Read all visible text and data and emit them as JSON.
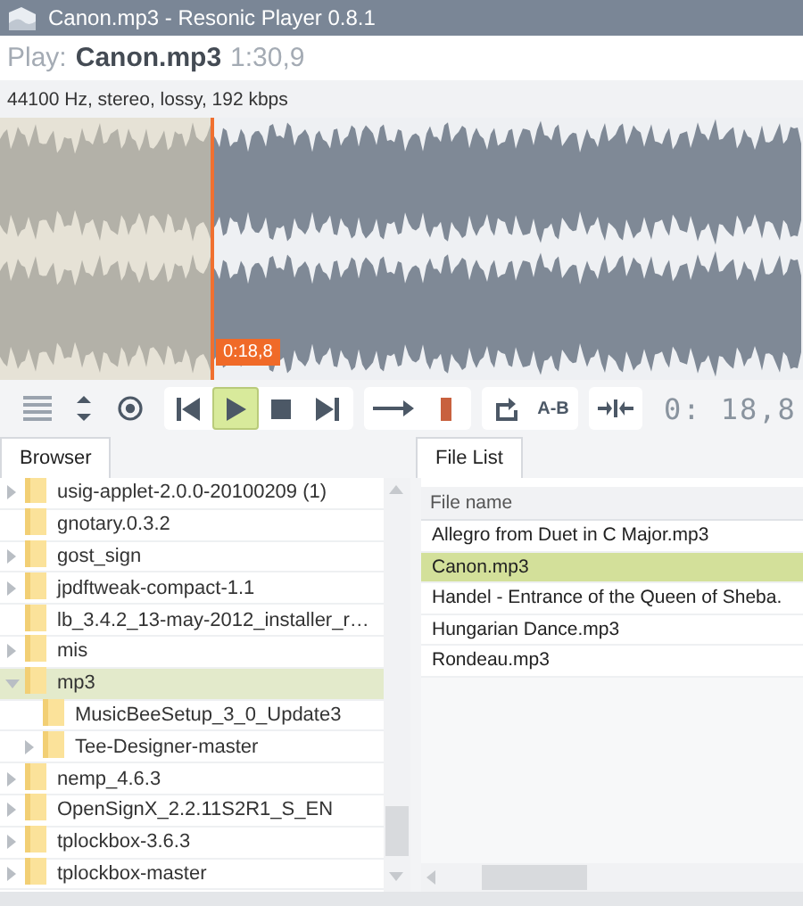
{
  "window": {
    "title": "Canon.mp3 - Resonic Player 0.8.1"
  },
  "now_playing": {
    "prefix": "Play:",
    "file": "Canon.mp3",
    "duration": "1:30,9"
  },
  "info": "44100 Hz, stereo, lossy, 192 kbps",
  "waveform": {
    "position_label": "0:18,8",
    "level": 0.265
  },
  "transport": [
    {
      "kind": "previous",
      "selected": false
    },
    {
      "kind": "play",
      "selected": true
    },
    {
      "kind": "stop",
      "selected": false
    },
    {
      "kind": "next",
      "selected": false
    }
  ],
  "ab_button": "A-B",
  "time_display": "0: 18,8",
  "tabs": [
    {
      "label": "Browser",
      "selected": true
    },
    {
      "label": "File List",
      "selected": true
    }
  ],
  "browser": [
    {
      "label": "usig-applet-2.0.0-20100209 (1)",
      "expanded": false,
      "selected": false
    },
    {
      "label": "gnotary.0.3.2",
      "selected": false
    },
    {
      "label": "gost_sign",
      "expanded": false,
      "selected": false
    },
    {
      "label": "jpdftweak-compact-1.1",
      "expanded": false,
      "selected": false
    },
    {
      "label": "lb_3.4.2_13-may-2012_installer_r…",
      "selected": false
    },
    {
      "label": "mis",
      "expanded": false,
      "selected": false
    },
    {
      "label": "mp3",
      "expanded": true,
      "selected": true,
      "children": [
        {
          "label": "MusicBeeSetup_3_0_Update3",
          "selected": false
        },
        {
          "label": "Tee-Designer-master",
          "expanded": false,
          "selected": false
        }
      ]
    },
    {
      "label": "nemp_4.6.3",
      "expanded": false,
      "selected": false
    },
    {
      "label": "OpenSignX_2.2.11S2R1_S_EN",
      "expanded": false,
      "selected": false
    },
    {
      "label": "tplockbox-3.6.3",
      "expanded": false,
      "selected": false
    },
    {
      "label": "tplockbox-master",
      "expanded": false,
      "selected": false
    }
  ],
  "file_list": {
    "column": "File name",
    "rows": [
      {
        "name": "Allegro from Duet in C Major.mp3",
        "selected": false
      },
      {
        "name": "Canon.mp3",
        "selected": true
      },
      {
        "name": "Handel - Entrance of the Queen of Sheba.",
        "selected": false
      },
      {
        "name": "Hungarian Dance.mp3",
        "selected": false
      },
      {
        "name": "Rondeau.mp3",
        "selected": false
      }
    ]
  }
}
